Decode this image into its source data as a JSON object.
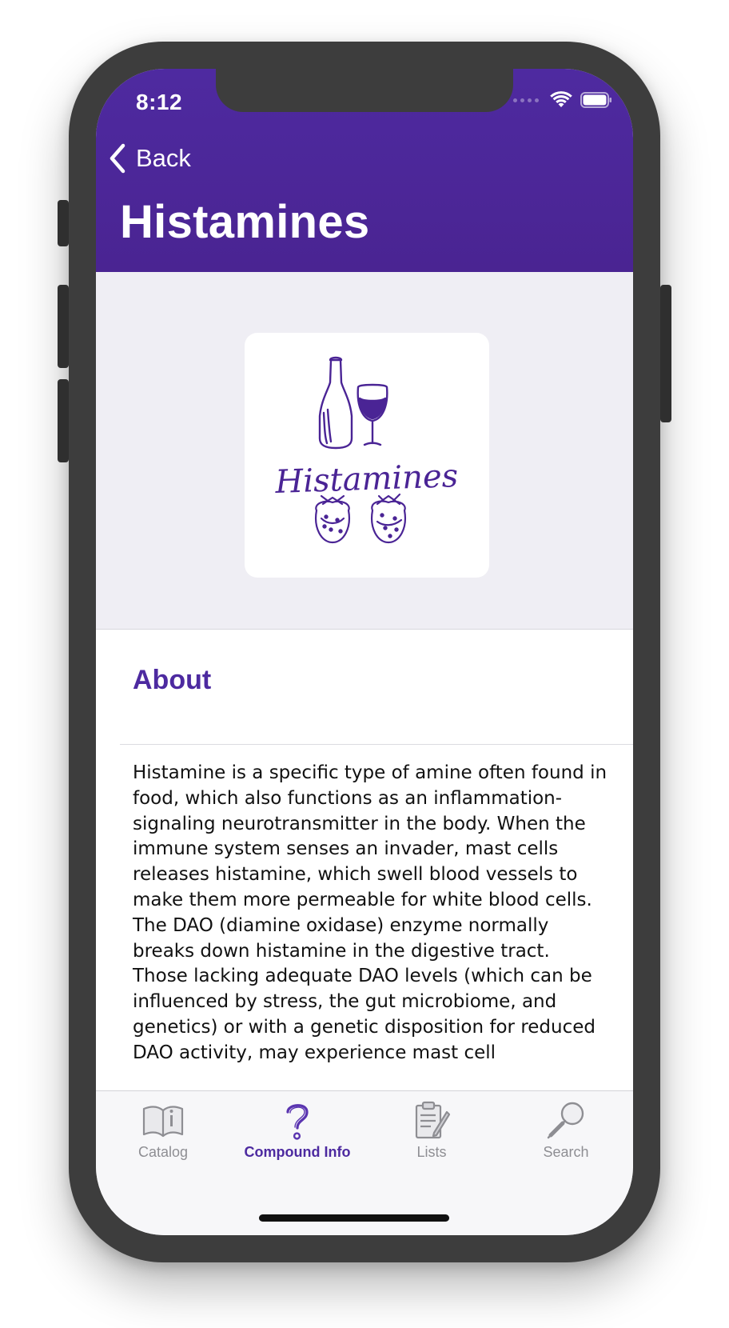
{
  "status_bar": {
    "time": "8:12"
  },
  "nav": {
    "back_label": "Back",
    "title": "Histamines"
  },
  "hero": {
    "image_caption": "Histamines"
  },
  "about": {
    "heading": "About",
    "body": "Histamine is a specific type of amine often found in food, which also functions as an inflammation-signaling neurotransmitter in the body. When the immune system senses an invader, mast cells releases histamine, which swell blood vessels to make them more permeable for white blood cells. The DAO (diamine oxidase) enzyme normally breaks down histamine in the digestive tract. Those lacking adequate DAO levels (which can be influenced by stress, the gut microbiome, and genetics) or with a genetic disposition for reduced DAO activity, may experience mast cell"
  },
  "tabs": [
    {
      "label": "Catalog",
      "icon": "book-icon",
      "active": false
    },
    {
      "label": "Compound Info",
      "icon": "question-mark-icon",
      "active": true
    },
    {
      "label": "Lists",
      "icon": "clipboard-icon",
      "active": false
    },
    {
      "label": "Search",
      "icon": "magnifier-icon",
      "active": false
    }
  ],
  "colors": {
    "brand": "#4d2aa0",
    "inactive_tab": "#8e8e93",
    "background": "#efeef4"
  }
}
